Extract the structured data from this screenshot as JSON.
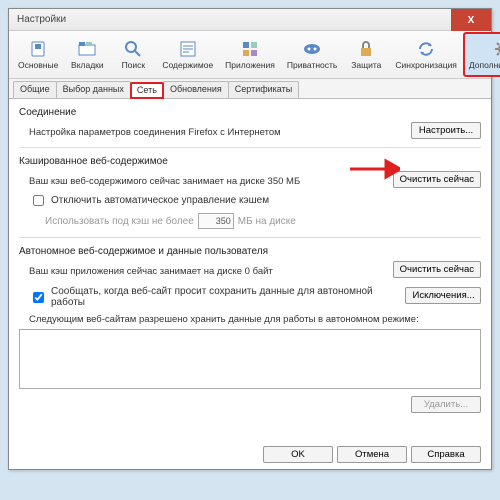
{
  "title": "Настройки",
  "close": "X",
  "toolbar": [
    {
      "label": "Основные",
      "icon": "switch"
    },
    {
      "label": "Вкладки",
      "icon": "tabs"
    },
    {
      "label": "Поиск",
      "icon": "search"
    },
    {
      "label": "Содержимое",
      "icon": "content"
    },
    {
      "label": "Приложения",
      "icon": "apps"
    },
    {
      "label": "Приватность",
      "icon": "mask"
    },
    {
      "label": "Защита",
      "icon": "lock"
    },
    {
      "label": "Синхронизация",
      "icon": "sync"
    },
    {
      "label": "Дополнительные",
      "icon": "gear",
      "active": true,
      "hl": true
    }
  ],
  "tabs": [
    {
      "label": "Общие"
    },
    {
      "label": "Выбор данных"
    },
    {
      "label": "Сеть",
      "active": true,
      "hl": true
    },
    {
      "label": "Обновления"
    },
    {
      "label": "Сертификаты"
    }
  ],
  "conn": {
    "title": "Соединение",
    "desc": "Настройка параметров соединения Firefox с Интернетом",
    "btn": "Настроить..."
  },
  "cache": {
    "title": "Кэшированное веб-содержимое",
    "status": "Ваш кэш веб-содержимого сейчас занимает на диске 350 МБ",
    "clear": "Очистить сейчас",
    "override": "Отключить автоматическое управление кэшем",
    "limit_pre": "Использовать под кэш не более",
    "limit_val": "350",
    "limit_unit": "МБ на диске"
  },
  "offline": {
    "title": "Автономное веб-содержимое и данные пользователя",
    "status": "Ваш кэш приложения сейчас занимает на диске 0 байт",
    "clear": "Очистить сейчас",
    "notify": "Сообщать, когда веб-сайт просит сохранить данные для автономной работы",
    "exceptions": "Исключения...",
    "allowed": "Следующим веб-сайтам разрешено хранить данные для работы в автономном режиме:",
    "remove": "Удалить..."
  },
  "dialog": {
    "ok": "OK",
    "cancel": "Отмена",
    "help": "Справка"
  }
}
